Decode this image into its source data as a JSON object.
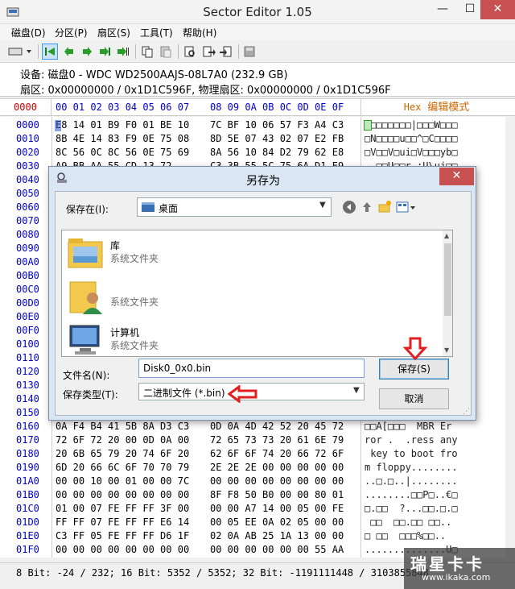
{
  "window": {
    "title": "Sector Editor 1.05",
    "min_glyph": "—",
    "max_glyph": "☐",
    "close_glyph": "✕"
  },
  "menu": [
    {
      "label": "磁盘(D)"
    },
    {
      "label": "分区(P)"
    },
    {
      "label": "扇区(S)"
    },
    {
      "label": "工具(T)"
    },
    {
      "label": "帮助(H)"
    }
  ],
  "device": {
    "line1": "设备: 磁盘0 - WDC WD2500AAJS-08L7A0 (232.9 GB)",
    "line2": "扇区: 0x00000000 / 0x1D1C596F, 物理扇区: 0x00000000 / 0x1D1C596F"
  },
  "hex_header": {
    "offset": "0000",
    "cols_a": "00 01 02 03 04 05 06 07",
    "cols_b": "08 09 0A 0B 0C 0D 0E 0F",
    "mode_prefix": "Hex",
    "mode_label": "编辑模式"
  },
  "hex_rows": [
    {
      "off": "0000",
      "h1": "E8 14 01 B9 F0 01 BE 10",
      "h2": "7C BF 10 06 57 F3 A4 C3",
      "asc": "□□□□□□□□|□□□W□□□"
    },
    {
      "off": "0010",
      "h1": "8B 4E 14 83 F9 0E 75 08",
      "h2": "8D 5E 07 43 02 07 E2 FB",
      "asc": "□N□□□□u□□^□C□□□□"
    },
    {
      "off": "0020",
      "h1": "8C 56 0C 8C 56 0E 75 69",
      "h2": "8A 56 10 84 D2 79 62 E8",
      "asc": "□V□□V□ui□V□□□yb□"
    },
    {
      "off": "0030",
      "h1": "A9 BB AA 55 CD 13 72 ..",
      "h2": "C3 3B 55 5C 75 6A D1 E9",
      "asc": "..□□U□□r.;U\\uj□□"
    },
    {
      "off": "0040",
      "h1": "",
      "h2": "",
      "asc": "□D"
    },
    {
      "off": "0050",
      "h1": "",
      "h2": "",
      "asc": "□□□€"
    },
    {
      "off": "0060",
      "h1": "",
      "h2": "",
      "asc": "□□□□"
    },
    {
      "off": "0070",
      "h1": "",
      "h2": "",
      "asc": "□P□F"
    },
    {
      "off": "0080",
      "h1": "",
      "h2": "",
      "asc": "□□□□"
    },
    {
      "off": "0090",
      "h1": "",
      "h2": "",
      "asc": "□□□□"
    },
    {
      "off": "00A0",
      "h1": "",
      "h2": "",
      "asc": "u□□□"
    },
    {
      "off": "00B0",
      "h1": "",
      "h2": "",
      "asc": "□ZX□"
    },
    {
      "off": "00C0",
      "h1": "",
      "h2": "",
      "asc": "r□@□"
    },
    {
      "off": "00D0",
      "h1": "",
      "h2": "",
      "asc": "□□W@"
    },
    {
      "off": "00E0",
      "h1": "",
      "h2": "",
      "asc": "□NO□"
    },
    {
      "off": "00F0",
      "h1": "",
      "h2": "",
      "asc": "□□□□"
    },
    {
      "off": "0100",
      "h1": "",
      "h2": "",
      "asc": "□□□□"
    },
    {
      "off": "0110",
      "h1": "",
      "h2": "",
      "asc": "□□□□"
    },
    {
      "off": "0120",
      "h1": "",
      "h2": "",
      "asc": "IR□□"
    },
    {
      "off": "0130",
      "h1": "",
      "h2": "",
      "asc": "□?□C"
    },
    {
      "off": "0140",
      "h1": "",
      "h2": "",
      "asc": "□□□□"
    },
    {
      "off": "0150",
      "h1": "",
      "h2": "",
      "asc": "□□□□"
    },
    {
      "off": "0160",
      "h1": "0A F4 B4 41 5B 8A D3 C3",
      "h2": "0D 0A 4D 42 52 20 45 72",
      "asc": "□□A[□□□  MBR Er"
    },
    {
      "off": "0170",
      "h1": "72 6F 72 20 00 0D 0A 00",
      "h2": "72 65 73 73 20 61 6E 79",
      "asc": "ror .  .ress any"
    },
    {
      "off": "0180",
      "h1": "20 6B 65 79 20 74 6F 20",
      "h2": "62 6F 6F 74 20 66 72 6F",
      "asc": " key to boot fro"
    },
    {
      "off": "0190",
      "h1": "6D 20 66 6C 6F 70 70 79",
      "h2": "2E 2E 2E 00 00 00 00 00",
      "asc": "m floppy........"
    },
    {
      "off": "01A0",
      "h1": "00 00 10 00 01 00 00 7C",
      "h2": "00 00 00 00 00 00 00 00",
      "asc": "..□.□..|........"
    },
    {
      "off": "01B0",
      "h1": "00 00 00 00 00 00 00 00",
      "h2": "8F F8 50 B0 00 00 80 01",
      "asc": "........□□P□..€□"
    },
    {
      "off": "01C0",
      "h1": "01 00 07 FE FF FF 3F 00",
      "h2": "00 00 A7 14 00 05 00 FE",
      "asc": "□.□□  ?...□□.□.□"
    },
    {
      "off": "01D0",
      "h1": "FF FF 07 FE FF FF E6 14",
      "h2": "00 05 EE 0A 02 05 00 00",
      "asc": " □□  □□.□□ □□.."
    },
    {
      "off": "01E0",
      "h1": "C3 FF 05 FE FF FF D6 1F",
      "h2": "02 0A AB 25 1A 13 00 00",
      "asc": "□ □□  □□□%□□.."
    },
    {
      "off": "01F0",
      "h1": "00 00 00 00 00 00 00 00",
      "h2": "00 00 00 00 00 00 55 AA",
      "asc": "..............U□"
    }
  ],
  "status": {
    "text": "8 Bit: -24 / 232;  16 Bit: 5352 / 5352;  32 Bit: -1191111448 / 3103855848"
  },
  "watermark": {
    "logo": "瑞星卡卡",
    "url": "www.ikaka.com"
  },
  "dialog": {
    "title": "另存为",
    "close_glyph": "✕",
    "save_in_label": "保存在(I):",
    "save_in_value": "桌面",
    "files": [
      {
        "name": "库",
        "type": "系统文件夹",
        "icon": "library-icon"
      },
      {
        "name": "",
        "type": "系统文件夹",
        "icon": "user-folder-icon"
      },
      {
        "name": "计算机",
        "type": "系统文件夹",
        "icon": "computer-icon"
      }
    ],
    "filename_label": "文件名(N):",
    "filename_value": "Disk0_0x0.bin",
    "filetype_label": "保存类型(T):",
    "filetype_value": "二进制文件 (*.bin)",
    "save_button": "保存(S)",
    "cancel_button": "取消"
  },
  "colors": {
    "offset_blue": "#0000cc",
    "mode_orange": "#cc6600",
    "annotation_red": "#e02020",
    "close_red": "#c75050"
  }
}
